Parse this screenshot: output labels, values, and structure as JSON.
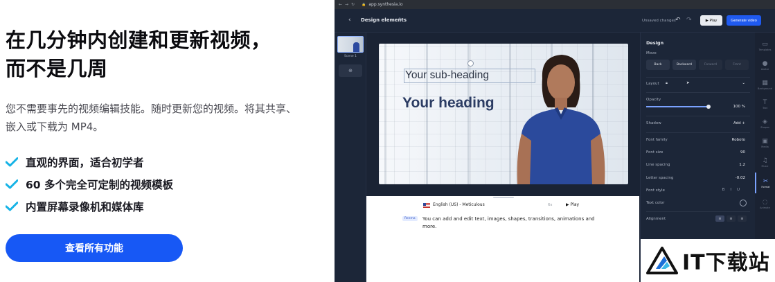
{
  "hero": {
    "title_line1": "在几分钟内创建和更新视频，",
    "title_line2": "而不是几周",
    "description": "您不需要事先的视频编辑技能。随时更新您的视频。将其共享、嵌入或下载为 MP4。",
    "features": [
      "直观的界面，适合初学者",
      "60 多个完全可定制的视频模板",
      "内置屏幕录像机和媒体库"
    ],
    "cta_label": "查看所有功能",
    "accent_color": "#1758f5",
    "check_color": "#16b3e6"
  },
  "browser": {
    "url": "app.synthesia.io"
  },
  "app": {
    "title": "Design elements",
    "unsaved_label": "Unsaved changes",
    "play_label": "Play",
    "generate_label": "Generate video",
    "scene_label": "Scene 1",
    "canvas": {
      "subheading": "Your sub-heading",
      "heading": "Your heading"
    },
    "script": {
      "voice": "English (US) - Meticulous",
      "speed": "6s",
      "play_label": "Play",
      "avatar_tag": "Reema",
      "text": "You can add and edit text, images, shapes, transitions, animations and more."
    },
    "design_panel": {
      "title": "Design",
      "move_label": "Move",
      "move_buttons": [
        "Back",
        "Backward",
        "Forward",
        "Front"
      ],
      "layout_label": "Layout",
      "opacity_label": "Opacity",
      "opacity_value": "100 %",
      "opacity_fraction": 1.0,
      "shadow_label": "Shadow",
      "shadow_action": "Add +",
      "font_family_label": "Font family",
      "font_family_value": "Roboto",
      "font_size_label": "Font size",
      "font_size_value": "90",
      "line_spacing_label": "Line spacing",
      "line_spacing_value": "1.2",
      "letter_spacing_label": "Letter spacing",
      "letter_spacing_value": "-0.02",
      "font_style_label": "Font style",
      "text_color_label": "Text color",
      "alignment_label": "Alignment"
    },
    "rail": [
      "Templates",
      "Avatar",
      "Background",
      "Text",
      "Shapes",
      "Media",
      "Music",
      "Format",
      "Animate"
    ]
  },
  "watermark": {
    "text": "IT下载站"
  }
}
